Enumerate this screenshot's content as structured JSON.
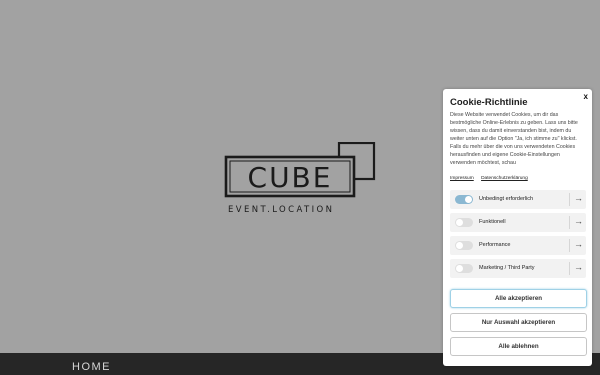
{
  "logo": {
    "text": "CUBE",
    "tagline": "EVENT.LOCATION"
  },
  "nav": {
    "home_label": "HOME",
    "other_items": [
      "",
      "",
      "",
      ""
    ]
  },
  "cookie": {
    "close_label": "x",
    "title": "Cookie-Richtlinie",
    "body": "Diese Website verwendet Cookies, um dir das bestmögliche Online-Erlebnis zu geben. Lass uns bitte wissen, dass du damit einverstanden bist, indem du weiter unten auf die Option \"Ja, ich stimme zu\" klickst. Falls du mehr über die von uns verwendeten Cookies herausfinden und eigene Cookie-Einstellungen verwenden möchtest, schau",
    "links": {
      "imprint": "Impressum",
      "privacy": "Datenschutzerklärung"
    },
    "options": [
      {
        "label": "Unbedingt erforderlich",
        "enabled": true
      },
      {
        "label": "Funktionell",
        "enabled": false
      },
      {
        "label": "Performance",
        "enabled": false
      },
      {
        "label": "Marketing / Third Party",
        "enabled": false
      }
    ],
    "buttons": {
      "accept_all": "Alle akzeptieren",
      "accept_selection": "Nur Auswahl akzeptieren",
      "reject_all": "Alle ablehnen"
    },
    "accent_color": "#8bb8d2"
  }
}
